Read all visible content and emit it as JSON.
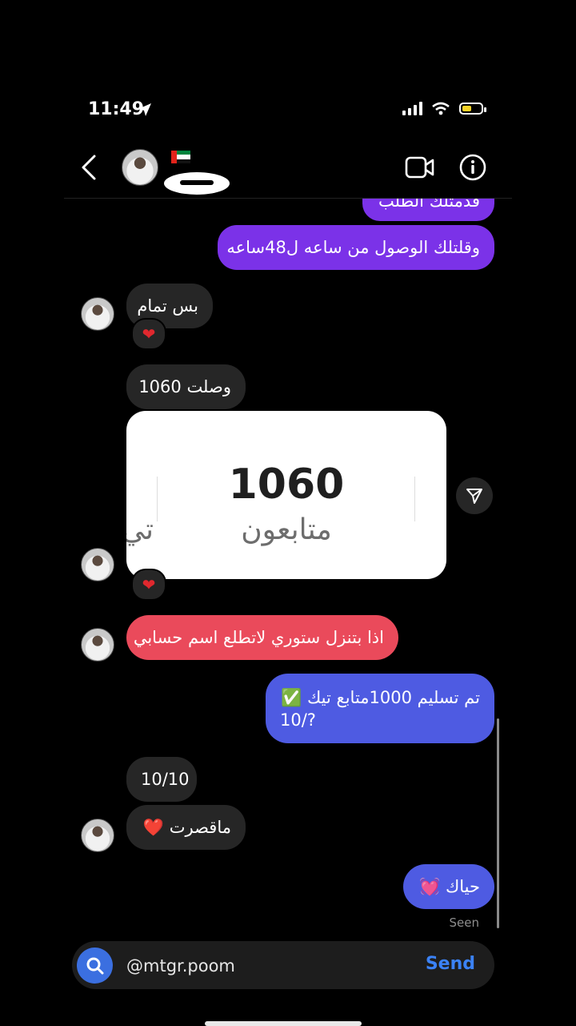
{
  "status_bar": {
    "time": "11:49"
  },
  "header": {
    "back_icon": "chevron-left-icon",
    "flag": "uae-flag",
    "video_icon": "video-camera-icon",
    "info_icon": "info-icon"
  },
  "messages": {
    "m0_partial": "قدمتلك الطلب",
    "m1": "وقلتلك الوصول من ساعه ل48ساعه",
    "m2": "بس تمام",
    "m3": "وصلت 1060",
    "m4_image_number": "1060",
    "m4_image_label": "متابعون",
    "m4_image_label_cut": "تي",
    "m5": "اذا بتنزل ستوري لاتطلع اسم حسابي",
    "m6_line1": "تم تسليم 1000متابع تيك ✅",
    "m6_line2": "10/?",
    "m7": "10/10",
    "m8": "ماقصرت ❤️",
    "m9": "حياك 💓"
  },
  "reactions": {
    "r1": "❤",
    "r2": "❤"
  },
  "seen_label": "Seen",
  "composer": {
    "value": "@mtgr.poom",
    "send_label": "Send"
  },
  "colors": {
    "sent_purple": "#7b32e8",
    "sent_blue": "#4e5be2",
    "received_red": "#ea4a5b",
    "received_gray": "#262626",
    "accent": "#3b82f6"
  }
}
